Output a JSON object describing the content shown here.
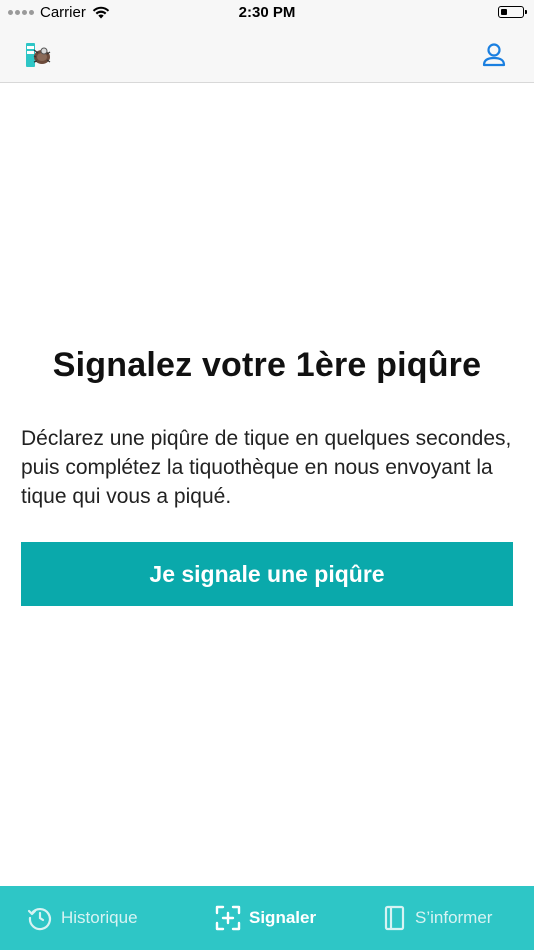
{
  "status_bar": {
    "carrier": "Carrier",
    "time": "2:30 PM",
    "battery_level": 0.3
  },
  "nav": {
    "logo_icon": "tick-app-logo",
    "profile_icon": "user-profile-icon"
  },
  "main": {
    "title": "Signalez votre 1ère piqûre",
    "description": "Déclarez une piqûre de tique en quelques secondes, puis complétez la tiquothèque en nous envoyant la tique qui vous a piqué.",
    "cta_label": "Je signale une piqûre"
  },
  "tabs": [
    {
      "label": "Historique",
      "icon": "history-icon",
      "active": false
    },
    {
      "label": "Signaler",
      "icon": "scan-add-icon",
      "active": true
    },
    {
      "label": "S’informer",
      "icon": "book-icon",
      "active": false
    }
  ],
  "colors": {
    "accent": "#0aa9ab",
    "tab_bar": "#2ec6c6",
    "profile_icon": "#1a7fe0"
  }
}
